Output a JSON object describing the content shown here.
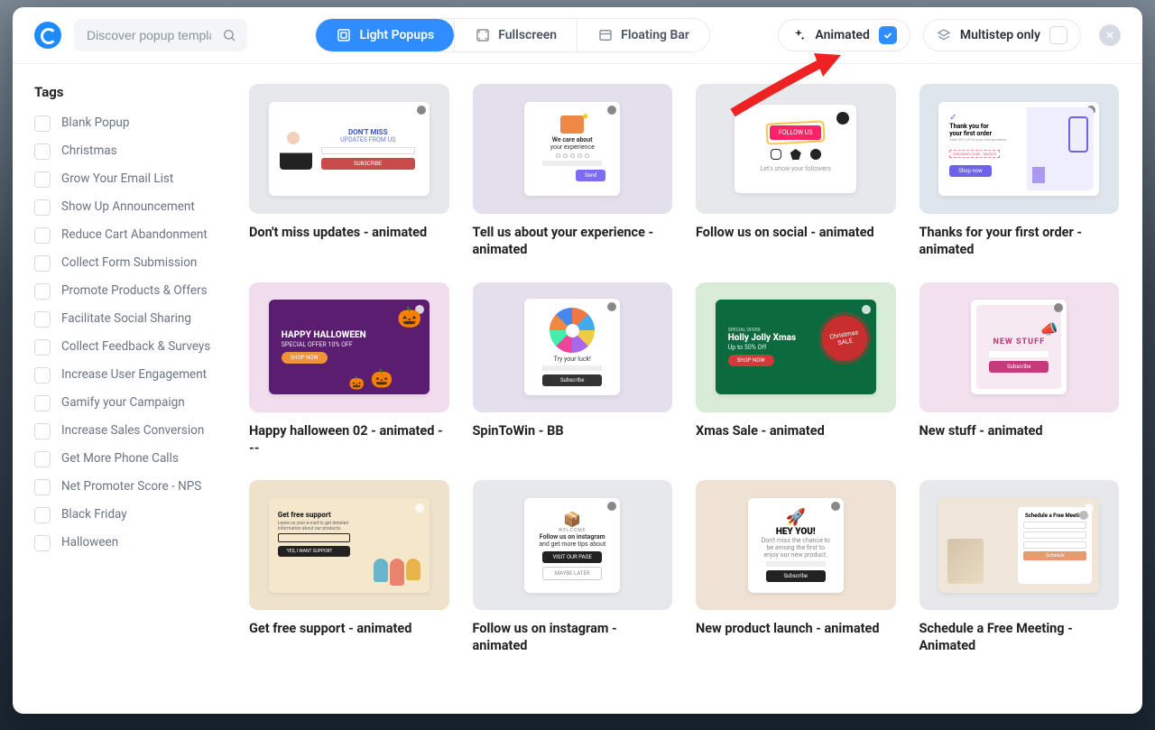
{
  "search": {
    "placeholder": "Discover popup templates"
  },
  "segmented": [
    {
      "label": "Light Popups",
      "active": true
    },
    {
      "label": "Fullscreen",
      "active": false
    },
    {
      "label": "Floating Bar",
      "active": false
    }
  ],
  "filters": {
    "animated": {
      "label": "Animated",
      "checked": true
    },
    "multistep": {
      "label": "Multistep only",
      "checked": false
    }
  },
  "sidebar": {
    "title": "Tags",
    "items": [
      {
        "label": "Blank Popup"
      },
      {
        "label": "Christmas"
      },
      {
        "label": "Grow Your Email List"
      },
      {
        "label": "Show Up Announcement"
      },
      {
        "label": "Reduce Cart Abandonment"
      },
      {
        "label": "Collect Form Submission"
      },
      {
        "label": "Promote Products & Offers"
      },
      {
        "label": "Facilitate Social Sharing"
      },
      {
        "label": "Collect Feedback & Surveys"
      },
      {
        "label": "Increase User Engagement"
      },
      {
        "label": "Gamify your Campaign"
      },
      {
        "label": "Increase Sales Conversion"
      },
      {
        "label": "Get More Phone Calls"
      },
      {
        "label": "Net Promoter Score - NPS"
      },
      {
        "label": "Black Friday"
      },
      {
        "label": "Halloween"
      }
    ]
  },
  "cards": [
    {
      "title": "Don't miss updates - animated",
      "bg": "gray",
      "mock_title": "DON'T MISS",
      "mock_sub": "UPDATES FROM US",
      "mock_btn": "SUBSCRIBE",
      "mock_btn_bg": "#c94a4a"
    },
    {
      "title": "Tell us about your experience - animated",
      "bg": "lav",
      "mock_title": "We care about",
      "mock_sub": "your experience",
      "mock_btn": "Send",
      "mock_btn_bg": "#7c6cf4"
    },
    {
      "title": "Follow us on social - animated",
      "bg": "gray",
      "mock_title": "FOLLOW US",
      "mock_sub": "Let's show your followers",
      "social": true
    },
    {
      "title": "Thanks for your first order - animated",
      "bg": "blue",
      "mock_title": "Thank you for",
      "mock_sub": "your first order",
      "mock_btn": "Shop now",
      "mock_btn_bg": "#6e62e5"
    },
    {
      "title": "Happy halloween 02 - animated - --",
      "bg": "pink",
      "full": true,
      "mock_bg": "#5a1d6f",
      "mock_title": "HAPPY HALLOWEEN",
      "mock_sub": "SPECIAL OFFER 10% OFF",
      "mock_btn": "SHOP NOW",
      "mock_btn_bg": "#f0923a"
    },
    {
      "title": "SpinToWin - BB",
      "bg": "lav",
      "wheel": true,
      "mock_sub": "Try your luck!",
      "mock_btn": "Subscribe",
      "mock_btn_bg": "#333"
    },
    {
      "title": "Xmas Sale - animated",
      "bg": "green",
      "full": true,
      "mock_bg": "#0c6b3e",
      "mock_title": "Holly Jolly Xmas",
      "mock_pre": "SPECIAL OFFER",
      "mock_sub": "Up to 50% Off",
      "mock_btn": "SHOP NOW",
      "mock_btn_bg": "#d13a3a",
      "badge": "Christmas SALE"
    },
    {
      "title": "New stuff - animated",
      "bg": "lpink",
      "mock_bg2": "#f7e9f1",
      "mock_title": "NEW STUFF",
      "mock_btn": "Subscribe",
      "mock_btn_bg": "#c53a7a"
    },
    {
      "title": "Get free support - animated",
      "bg": "beige",
      "full": true,
      "mock_bg": "#f5e7cc",
      "mock_title": "Get free support",
      "mock_sub": "Leave us your e-mail to get detailed information about our products.",
      "mock_btn": "YES, I WANT SUPPORT",
      "mock_btn_bg": "#222"
    },
    {
      "title": "Follow us on instagram - animated",
      "bg": "gray",
      "mock_title": "Follow us on instagram",
      "mock_sub": "and get more tips about",
      "mock_btn": "VISIT OUR PAGE",
      "mock_btn_bg": "#222",
      "mock_pre": "WELCOME"
    },
    {
      "title": "New product launch - animated",
      "bg": "tan",
      "mock_title": "HEY YOU!",
      "mock_sub": "Don't miss the chance to be among the first to enjoy our new product.",
      "mock_btn": "Subscribe",
      "mock_btn_bg": "#222"
    },
    {
      "title": "Schedule a Free Meeting - Animated",
      "bg": "gray",
      "full": true,
      "mock_bg": "#efe5d9",
      "mock_title": "Schedule a Free Meeting",
      "mock_btn": "Schedule",
      "mock_btn_bg": "#e89a6e",
      "form": true
    }
  ]
}
